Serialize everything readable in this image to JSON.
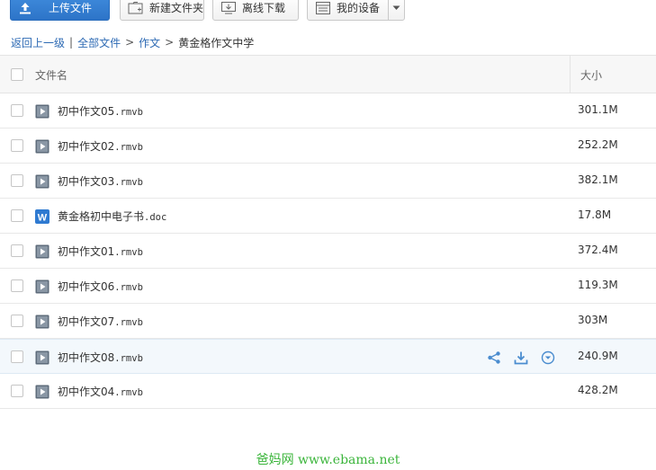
{
  "toolbar": {
    "upload_label": "上传文件",
    "new_folder_label": "新建文件夹",
    "offline_download_label": "离线下载",
    "my_device_label": "我的设备"
  },
  "breadcrumb": {
    "back": "返回上一级",
    "divider": "|",
    "all_files": "全部文件",
    "folder": "作文",
    "current": "黄金格作文中学",
    "arrow": ">"
  },
  "columns": {
    "name": "文件名",
    "size": "大小"
  },
  "files": [
    {
      "base": "初中作文05",
      "ext": ".rmvb",
      "size": "301.1M",
      "type": "video"
    },
    {
      "base": "初中作文02",
      "ext": ".rmvb",
      "size": "252.2M",
      "type": "video"
    },
    {
      "base": "初中作文03",
      "ext": ".rmvb",
      "size": "382.1M",
      "type": "video"
    },
    {
      "base": "黄金格初中电子书",
      "ext": ".doc",
      "size": "17.8M",
      "type": "word"
    },
    {
      "base": "初中作文01",
      "ext": ".rmvb",
      "size": "372.4M",
      "type": "video"
    },
    {
      "base": "初中作文06",
      "ext": ".rmvb",
      "size": "119.3M",
      "type": "video"
    },
    {
      "base": "初中作文07",
      "ext": ".rmvb",
      "size": "303M",
      "type": "video"
    },
    {
      "base": "初中作文08",
      "ext": ".rmvb",
      "size": "240.9M",
      "type": "video"
    },
    {
      "base": "初中作文04",
      "ext": ".rmvb",
      "size": "428.2M",
      "type": "video"
    }
  ],
  "word_icon_letter": "W",
  "row_action_icons": [
    "share-icon",
    "download-icon",
    "more-icon"
  ],
  "watermark": "爸妈网 www.ebama.net",
  "colors": {
    "accent": "#2d74c8",
    "link": "#2d6ab4",
    "watermark": "#3bb53b",
    "word_icon": "#2f7ad1"
  }
}
